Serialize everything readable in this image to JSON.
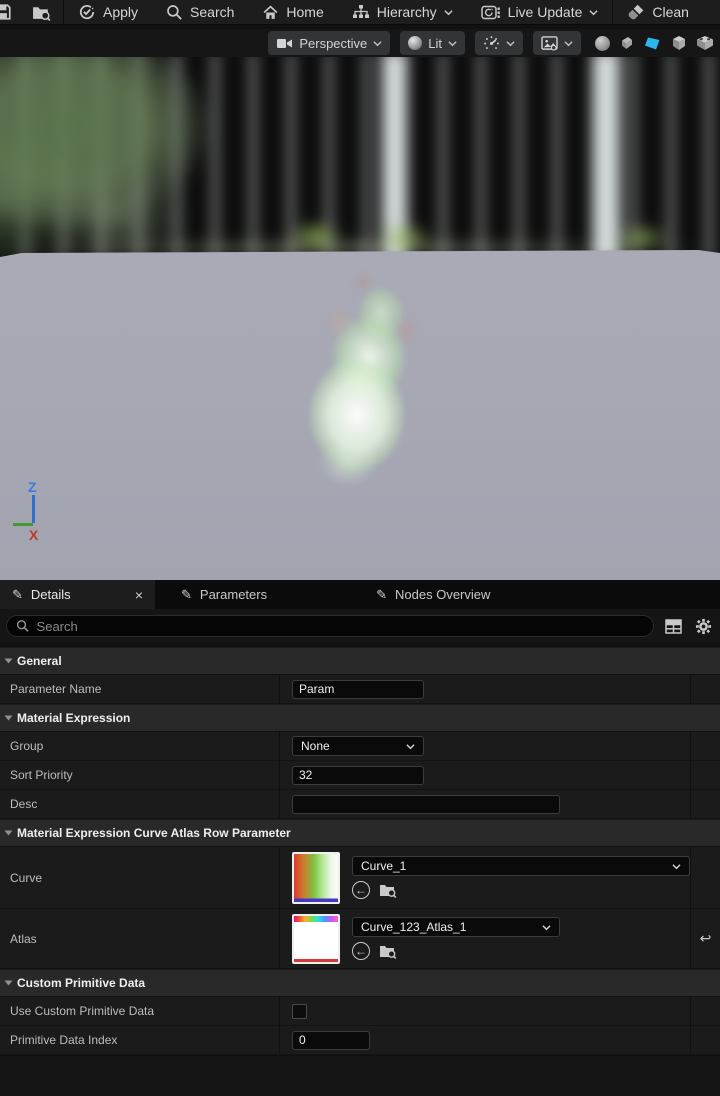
{
  "top_toolbar": {
    "save_icon": "save-icon",
    "browse_icon": "browse-icon",
    "apply": "Apply",
    "search": "Search",
    "home": "Home",
    "hierarchy": "Hierarchy",
    "live_update": "Live Update",
    "clean": "Clean"
  },
  "viewport_toolbar": {
    "perspective": "Perspective",
    "lit": "Lit"
  },
  "viewport": {
    "axis_z": "Z",
    "axis_x": "X"
  },
  "tabs": {
    "details": "Details",
    "details_close": "×",
    "parameters": "Parameters",
    "nodes_overview": "Nodes Overview",
    "pencil_icon": "✎"
  },
  "search": {
    "placeholder": "Search"
  },
  "sections": {
    "general": "General",
    "material_expression": "Material Expression",
    "curve_atlas": "Material Expression Curve Atlas Row Parameter",
    "custom_primitive": "Custom Primitive Data"
  },
  "rows": {
    "parameter_name": {
      "label": "Parameter Name",
      "value": "Param"
    },
    "group": {
      "label": "Group",
      "value": "None"
    },
    "sort_priority": {
      "label": "Sort Priority",
      "value": "32"
    },
    "desc": {
      "label": "Desc",
      "value": ""
    },
    "curve": {
      "label": "Curve",
      "value": "Curve_1"
    },
    "atlas": {
      "label": "Atlas",
      "value": "Curve_123_Atlas_1",
      "revert_icon": "↩"
    },
    "use_custom_primitive_data": {
      "label": "Use Custom Primitive Data",
      "checked": false
    },
    "primitive_data_index": {
      "label": "Primitive Data Index",
      "value": "0"
    }
  },
  "colors": {
    "accent_plane_icon": "#2bb7ee",
    "floor": "#a6a7b3",
    "panel_bg": "#151515",
    "header_bg": "#292929",
    "field_bg": "#0a0a0a"
  }
}
